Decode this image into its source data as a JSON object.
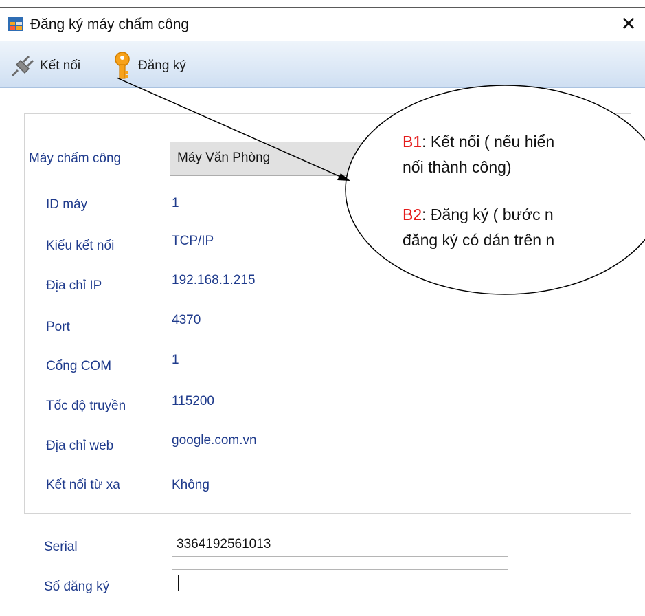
{
  "window": {
    "title": "Đăng ký máy chấm công",
    "close_icon": "close-icon"
  },
  "toolbar": {
    "connect_label": "Kết nối",
    "register_label": "Đăng ký",
    "connect_icon": "plug-icon",
    "register_icon": "key-icon"
  },
  "form": {
    "device_label": "Máy chấm công",
    "device_value": "Máy Văn Phòng",
    "fields": [
      {
        "label": "ID máy",
        "value": "1"
      },
      {
        "label": "Kiểu kết nối",
        "value": "TCP/IP"
      },
      {
        "label": "Địa chỉ IP",
        "value": "192.168.1.215"
      },
      {
        "label": "Port",
        "value": "4370"
      },
      {
        "label": "Cổng COM",
        "value": "1"
      },
      {
        "label": "Tốc độ truyền",
        "value": "115200"
      },
      {
        "label": "Địa chỉ web",
        "value": "google.com.vn"
      },
      {
        "label": "Kết nối từ xa",
        "value": "Không"
      }
    ],
    "serial_label": "Serial",
    "serial_value": "3364192561013",
    "regno_label": "Số đăng ký",
    "regno_value": ""
  },
  "callout": {
    "b1_tag": "B1",
    "b1_text_line1": ": Kết nối ( nếu hiển",
    "b1_text_line2": "nối thành công)",
    "b2_tag": "B2",
    "b2_text_line1": ": Đăng ký ( bước n",
    "b2_text_line2": "đăng ký có dán trên n"
  },
  "colors": {
    "label_blue": "#1f3b8c",
    "step_red": "#e41b1b",
    "toolbar_blue": "#dce8f6"
  }
}
